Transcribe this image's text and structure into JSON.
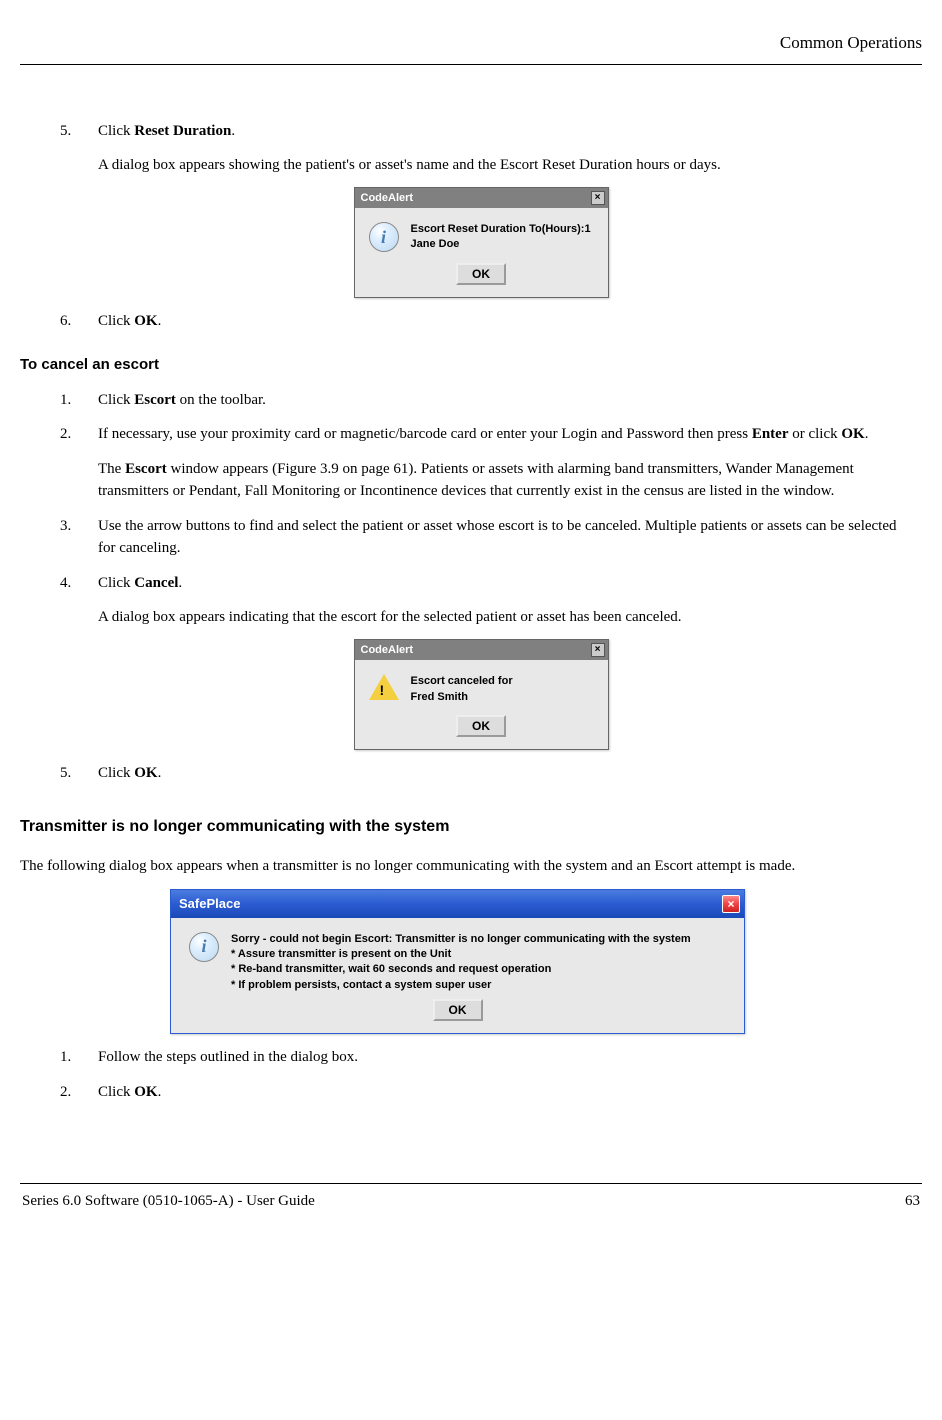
{
  "header": {
    "chapter": "Common Operations"
  },
  "list1": {
    "i5": {
      "num": "5.",
      "text_pre": "Click ",
      "bold": "Reset Duration",
      "text_post": ".",
      "desc": "A dialog box appears showing the patient's or asset's name and the Escort Reset Duration hours or days."
    },
    "i6": {
      "num": "6.",
      "text_pre": "Click ",
      "bold": "OK",
      "text_post": "."
    }
  },
  "dlg1": {
    "title": "CodeAlert",
    "line1": "Escort Reset Duration To(Hours):1",
    "line2": "Jane Doe",
    "ok": "OK"
  },
  "cancel_h": "To cancel an escort",
  "cancel": {
    "i1": {
      "num": "1.",
      "pre": "Click ",
      "b1": "Escort",
      "post": " on the toolbar."
    },
    "i2": {
      "num": "2.",
      "pre": "If necessary, use your proximity card or magnetic/barcode card or enter your Login and Password then press ",
      "b1": "Enter",
      "mid": " or click ",
      "b2": "OK",
      "post": ".",
      "p2_pre": "The ",
      "p2_b": "Escort",
      "p2_post": " window appears (Figure 3.9 on page 61). Patients or assets with alarming band transmitters, Wander Management transmitters or Pendant, Fall Monitoring or Incontinence devices that currently exist in the census are listed in the window."
    },
    "i3": {
      "num": "3.",
      "text": "Use the arrow buttons to find and select the patient or asset whose escort is to be canceled. Multiple patients or assets can be selected for canceling."
    },
    "i4": {
      "num": "4.",
      "pre": "Click ",
      "b1": "Cancel",
      "post": ".",
      "desc": "A dialog box appears indicating that the escort for the selected patient or asset has been canceled."
    },
    "i5": {
      "num": "5.",
      "pre": "Click ",
      "b1": "OK",
      "post": "."
    }
  },
  "dlg2": {
    "title": "CodeAlert",
    "line1": "Escort canceled for",
    "line2": "Fred Smith",
    "ok": "OK"
  },
  "trans_h": "Transmitter is no longer communicating with the system",
  "trans_intro": "The following dialog box appears when a transmitter is no longer communicating with the system and an Escort attempt is made.",
  "dlg3": {
    "title": "SafePlace",
    "l1": "Sorry - could not begin Escort: Transmitter is no longer communicating with the system",
    "l2": "* Assure transmitter is present on the Unit",
    "l3": "* Re-band transmitter, wait 60 seconds and request operation",
    "l4": "* If problem persists, contact a system super user",
    "ok": "OK"
  },
  "trans": {
    "i1": {
      "num": "1.",
      "text": "Follow the steps outlined in the dialog box."
    },
    "i2": {
      "num": "2.",
      "pre": "Click ",
      "b1": "OK",
      "post": "."
    }
  },
  "footer": {
    "left": "Series 6.0 Software (0510-1065-A) - User Guide",
    "right": "63"
  }
}
